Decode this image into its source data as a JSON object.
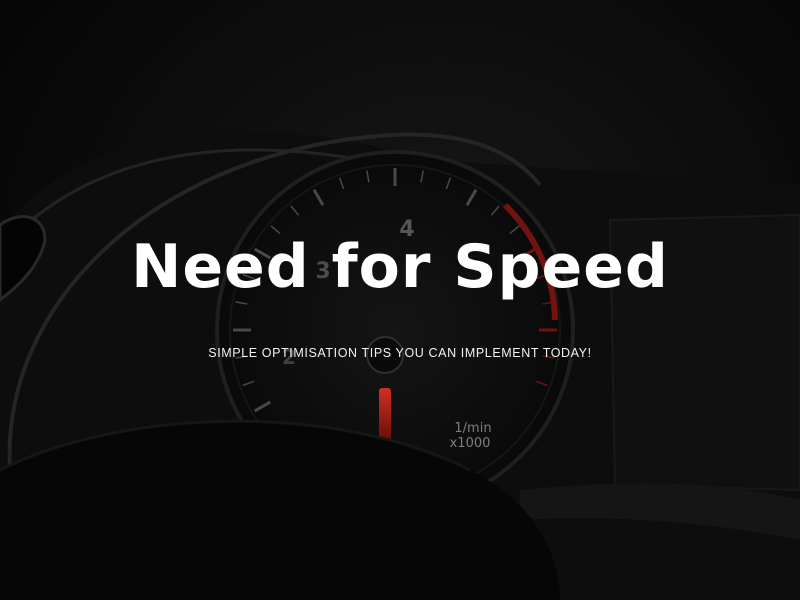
{
  "hero": {
    "title": "Need for Speed",
    "subtitle": "SIMPLE OPTIMISATION TIPS YOU CAN IMPLEMENT TODAY!"
  },
  "gauge": {
    "numbers": [
      "4",
      "3",
      "2"
    ],
    "unit_line1": "1/min",
    "unit_line2": "x1000",
    "accent_color": "#c0261f"
  },
  "colors": {
    "background": "#0b0b0b",
    "text": "#ffffff"
  }
}
